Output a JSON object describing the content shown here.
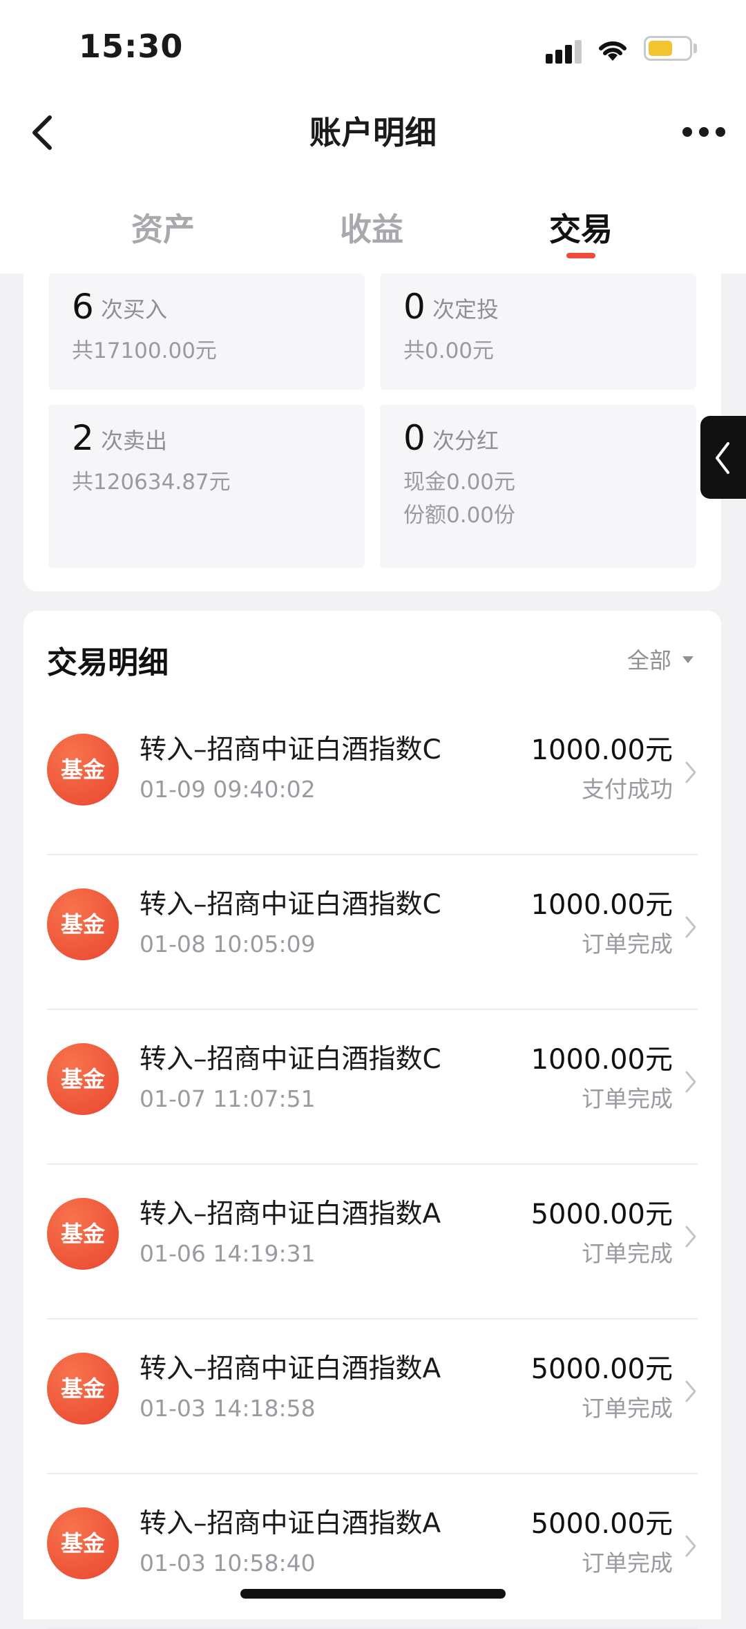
{
  "status_bar": {
    "time": "15:30"
  },
  "header": {
    "title": "账户明细"
  },
  "tabs": [
    {
      "label": "资产",
      "active": false
    },
    {
      "label": "收益",
      "active": false
    },
    {
      "label": "交易",
      "active": true
    }
  ],
  "summary": {
    "buy": {
      "count": "6",
      "label": "次买入",
      "sub": "共17100.00元"
    },
    "auto_invest": {
      "count": "0",
      "label": "次定投",
      "sub": "共0.00元"
    },
    "sell": {
      "count": "2",
      "label": "次卖出",
      "sub": "共120634.87元"
    },
    "dividend": {
      "count": "0",
      "label": "次分红",
      "sub_cash": "现金0.00元",
      "sub_shares": "份额0.00份"
    }
  },
  "details": {
    "title": "交易明细",
    "filter": "全部",
    "rows": [
      {
        "badge": "基金",
        "name": "转入–招商中证白酒指数C",
        "time": "01-09 09:40:02",
        "amount": "1000.00元",
        "status": "支付成功"
      },
      {
        "badge": "基金",
        "name": "转入–招商中证白酒指数C",
        "time": "01-08 10:05:09",
        "amount": "1000.00元",
        "status": "订单完成"
      },
      {
        "badge": "基金",
        "name": "转入–招商中证白酒指数C",
        "time": "01-07 11:07:51",
        "amount": "1000.00元",
        "status": "订单完成"
      },
      {
        "badge": "基金",
        "name": "转入–招商中证白酒指数A",
        "time": "01-06 14:19:31",
        "amount": "5000.00元",
        "status": "订单完成"
      },
      {
        "badge": "基金",
        "name": "转入–招商中证白酒指数A",
        "time": "01-03 14:18:58",
        "amount": "5000.00元",
        "status": "订单完成"
      },
      {
        "badge": "基金",
        "name": "转入–招商中证白酒指数A",
        "time": "01-03 10:58:40",
        "amount": "5000.00元",
        "status": "订单完成"
      }
    ]
  },
  "colors": {
    "accent": "#ef4b3b",
    "badge": "#e8462f",
    "battery": "#f4c430"
  },
  "icons": [
    "back-arrow-icon",
    "more-dots-icon",
    "chevron-right-icon",
    "chevron-left-icon",
    "signal-icon",
    "wifi-icon",
    "battery-icon",
    "caret-down-icon"
  ]
}
